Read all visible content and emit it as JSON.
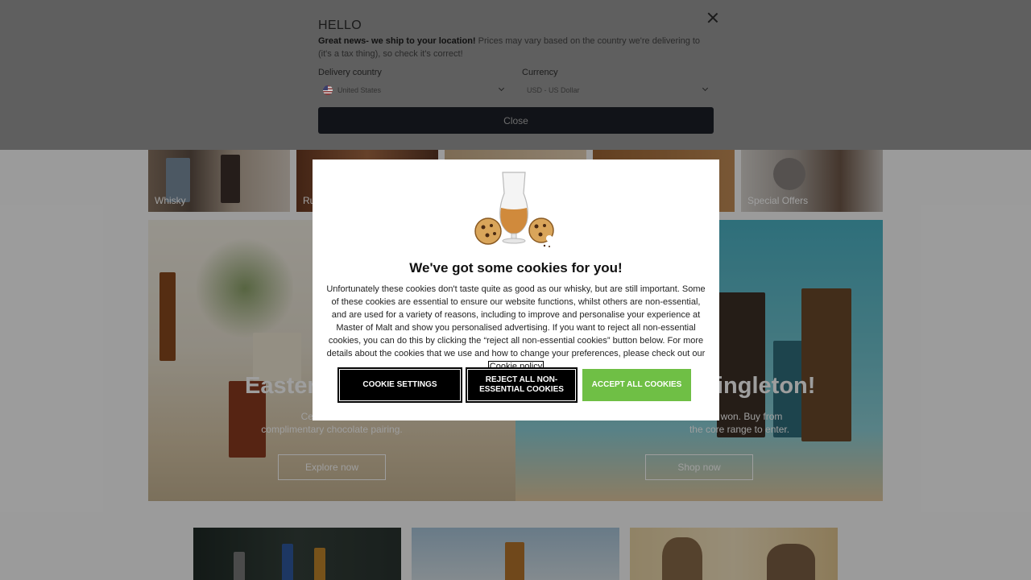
{
  "categories": [
    {
      "label": "Whisky"
    },
    {
      "label": "Ru"
    },
    {
      "label": ""
    },
    {
      "label": ""
    },
    {
      "label": "Special Offers"
    }
  ],
  "banners": {
    "left": {
      "title": "Easter E",
      "text": "Celebrate with\ncomplimentary chocolate pairing.",
      "button": "Explore now"
    },
    "right": {
      "title": "ingleton!",
      "text": "to be won. Buy from\nthe core range to enter.",
      "button": "Shop now"
    }
  },
  "delivery_panel": {
    "title": "HELLO",
    "message_bold": "Great news- we ship to your location!",
    "message_rest": " Prices may vary based on the country we're delivering to (it's a tax thing), so check it's correct!",
    "country_label": "Delivery country",
    "country_value": "United States",
    "currency_label": "Currency",
    "currency_value": "USD - US Dollar",
    "close_label": "Close"
  },
  "cookie_modal": {
    "title": "We've got some cookies for you!",
    "body": "Unfortunately these cookies don't taste quite as good as our whisky, but are still important. Some of these cookies are essential to ensure our website functions, whilst others are non-essential, and are used for a variety of reasons, including to improve and personalise your experience at Master of Malt and show you personalised advertising. If you want to reject all non-essential cookies, you can do this by clicking the “reject all non-essential cookies” button below. For more details about the cookies that we use and how to change your preferences, please check out our ",
    "policy_link": "Cookie policy",
    "settings_button": "COOKIE SETTINGS",
    "reject_button": "REJECT ALL NON-ESSENTIAL COOKIES",
    "accept_button": "ACCEPT ALL COOKIES",
    "accept_color": "#6fbf45"
  }
}
